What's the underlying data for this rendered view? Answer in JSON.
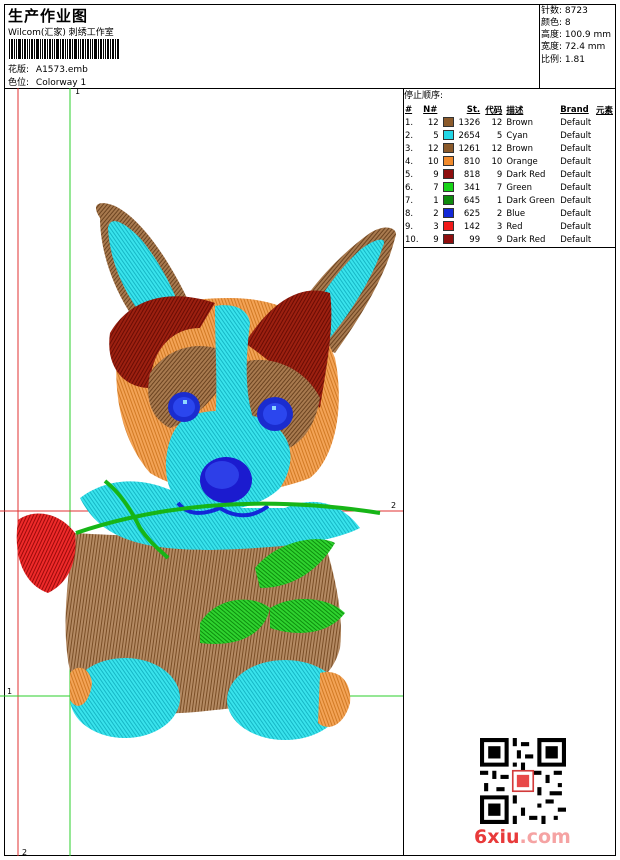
{
  "header": {
    "title": "生产作业图",
    "subtitle": "Wilcom(汇家) 刺绣工作室",
    "design_label": "花版:",
    "design_value": "A1573.emb",
    "colorway_label": "色位:",
    "colorway_value": "Colorway 1"
  },
  "info": {
    "stitches": "针数: 8723",
    "colors": "颜色: 8",
    "height": "高度: 100.9 mm",
    "width": "宽度: 72.4 mm",
    "scale": "比例: 1.81"
  },
  "stop_sequence": {
    "title": "停止顺序:",
    "headers": [
      "#",
      "N#",
      "St.",
      "代码",
      "描述",
      "Brand",
      "元素"
    ],
    "rows": [
      {
        "idx": "1.",
        "n": "12",
        "color": "#8B5A2B",
        "st": "1326",
        "code": "12",
        "desc": "Brown",
        "brand": "Default"
      },
      {
        "idx": "2.",
        "n": "5",
        "color": "#22D6E6",
        "st": "2654",
        "code": "5",
        "desc": "Cyan",
        "brand": "Default"
      },
      {
        "idx": "3.",
        "n": "12",
        "color": "#8B5A2B",
        "st": "1261",
        "code": "12",
        "desc": "Brown",
        "brand": "Default"
      },
      {
        "idx": "4.",
        "n": "10",
        "color": "#F08A2C",
        "st": "810",
        "code": "10",
        "desc": "Orange",
        "brand": "Default"
      },
      {
        "idx": "5.",
        "n": "9",
        "color": "#8E0E0E",
        "st": "818",
        "code": "9",
        "desc": "Dark Red",
        "brand": "Default"
      },
      {
        "idx": "6.",
        "n": "7",
        "color": "#18D418",
        "st": "341",
        "code": "7",
        "desc": "Green",
        "brand": "Default"
      },
      {
        "idx": "7.",
        "n": "1",
        "color": "#0E8A0E",
        "st": "645",
        "code": "1",
        "desc": "Dark Green",
        "brand": "Default"
      },
      {
        "idx": "8.",
        "n": "2",
        "color": "#1228D8",
        "st": "625",
        "code": "2",
        "desc": "Blue",
        "brand": "Default"
      },
      {
        "idx": "9.",
        "n": "3",
        "color": "#F01A1A",
        "st": "142",
        "code": "3",
        "desc": "Red",
        "brand": "Default"
      },
      {
        "idx": "10.",
        "n": "9",
        "color": "#8E0E0E",
        "st": "99",
        "code": "9",
        "desc": "Dark Red",
        "brand": "Default"
      }
    ]
  },
  "guides": {
    "top_v": "1",
    "right_h": "2",
    "left_h": "1",
    "bottom_v": "2"
  },
  "watermark": {
    "main": "6xiu",
    "tld": ".com"
  }
}
